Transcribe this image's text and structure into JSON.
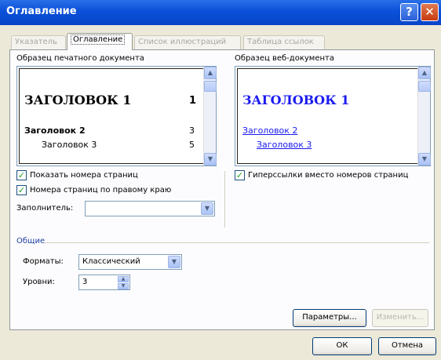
{
  "window": {
    "title": "Оглавление",
    "help_label": "?",
    "close_label": "✕"
  },
  "tabs": [
    {
      "label": "Указатель"
    },
    {
      "label": "Оглавление"
    },
    {
      "label": "Список иллюстраций"
    },
    {
      "label": "Таблица ссылок"
    }
  ],
  "print_preview": {
    "label": "Образец печатного документа",
    "heading1": "ЗАГОЛОВОК 1",
    "page1": "1",
    "heading2": "Заголовок 2",
    "page2": "3",
    "heading3": "Заголовок 3",
    "page3": "5"
  },
  "web_preview": {
    "label": "Образец веб-документа",
    "heading1": "ЗАГОЛОВОК 1",
    "heading2": "Заголовок 2",
    "heading3": "Заголовок 3"
  },
  "options": {
    "show_page_numbers": "Показать номера страниц",
    "align_right": "Номера страниц по правому краю",
    "hyperlinks": "Гиперссылки вместо номеров страниц",
    "leader_label": "Заполнитель:",
    "leader_value": ""
  },
  "general": {
    "label": "Общие",
    "formats_label": "Форматы:",
    "formats_value": "Классический",
    "levels_label": "Уровни:",
    "levels_value": "3"
  },
  "buttons": {
    "parameters": "Параметры...",
    "modify": "Изменить...",
    "ok": "ОК",
    "cancel": "Отмена"
  },
  "colors": {
    "titlebar": "#0a50d8",
    "link": "#1a1aef",
    "check": "#21a121"
  }
}
